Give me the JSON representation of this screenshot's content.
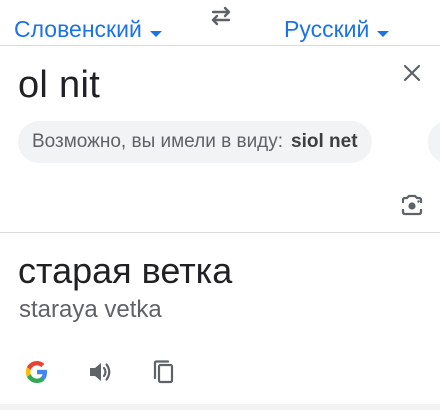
{
  "languages": {
    "source": "Словенский",
    "target": "Русский"
  },
  "input": {
    "text": "ol nit"
  },
  "suggestion": {
    "prefix": "Возможно, вы имели в виду:",
    "term": "siol net"
  },
  "output": {
    "translation": "старая ветка",
    "transliteration": "staraya vetka"
  },
  "icons": {
    "swap": "swap-arrows-icon",
    "close": "close-icon",
    "lens": "camera-lens-icon",
    "google": "google-logo-icon",
    "speak": "speaker-icon",
    "copy": "copy-icon"
  },
  "colors": {
    "accent": "#1a73e8",
    "text": "#202124",
    "muted": "#5f6368",
    "chip": "#f1f3f4"
  }
}
